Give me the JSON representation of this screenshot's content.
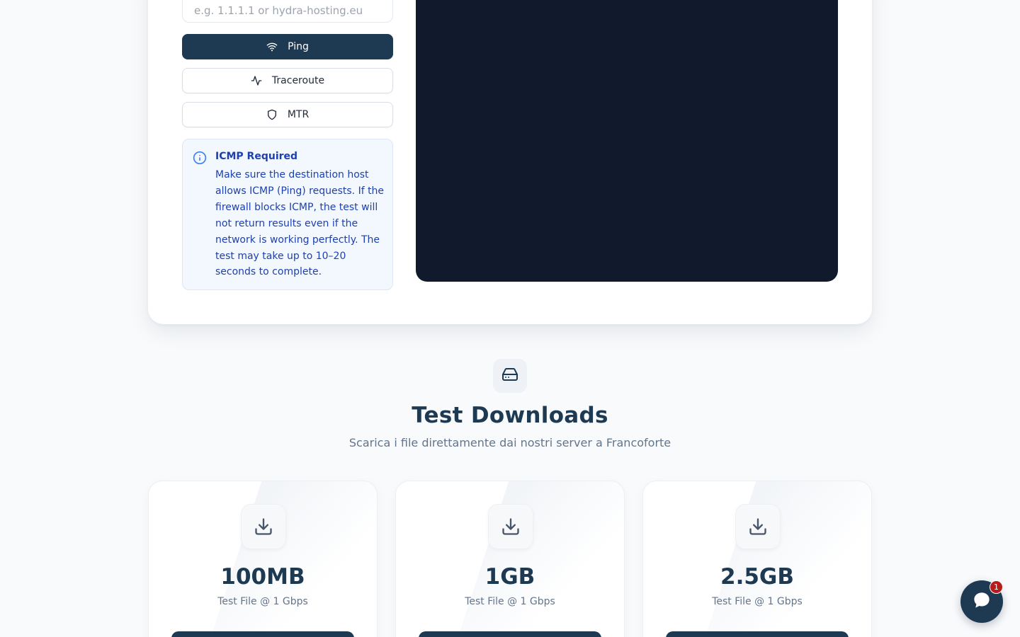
{
  "tool": {
    "host_placeholder": "e.g. 1.1.1.1 or hydra-hosting.eu",
    "buttons": [
      {
        "label": "Ping",
        "icon": "wifi-icon"
      },
      {
        "label": "Traceroute",
        "icon": "activity-icon"
      },
      {
        "label": "MTR",
        "icon": "shield-icon"
      }
    ],
    "notice": {
      "title": "ICMP Required",
      "text": "Make sure the destination host allows ICMP (Ping) requests. If the firewall blocks ICMP, the test will not return results even if the network is working perfectly. The test may take up to 10–20 seconds to complete."
    }
  },
  "downloads": {
    "title": "Test Downloads",
    "subtitle": "Scarica i file direttamente dai nostri server a Francoforte",
    "files": [
      {
        "size": "100MB",
        "desc": "Test File @ 1 Gbps"
      },
      {
        "size": "1GB",
        "desc": "Test File @ 1 Gbps"
      },
      {
        "size": "2.5GB",
        "desc": "Test File @ 1 Gbps"
      }
    ]
  },
  "chat": {
    "badge_count": "1"
  },
  "colors": {
    "primary": "#1e3a52",
    "terminal": "#111a2d",
    "notice_text": "#1e40af",
    "badge": "#b91c1c"
  }
}
